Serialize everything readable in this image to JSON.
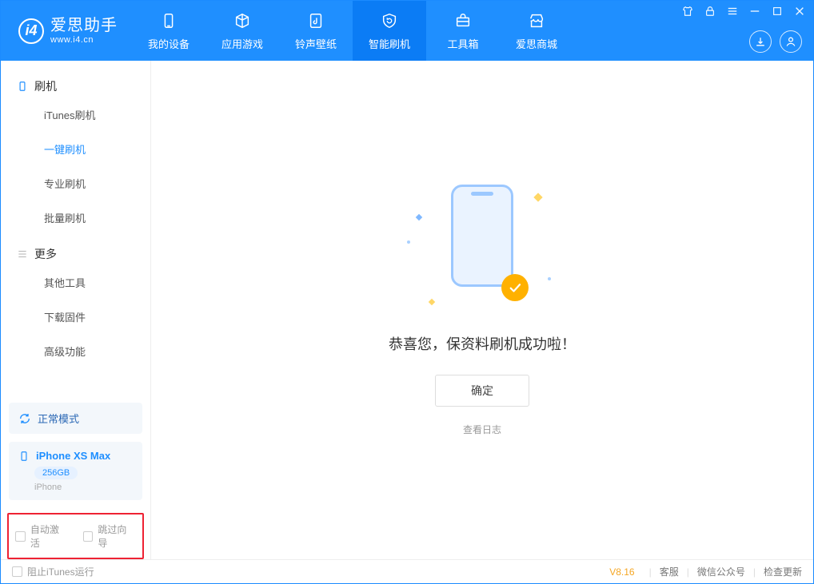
{
  "app": {
    "name": "爱思助手",
    "url": "www.i4.cn"
  },
  "tabs": [
    {
      "id": "device",
      "label": "我的设备"
    },
    {
      "id": "apps",
      "label": "应用游戏"
    },
    {
      "id": "ring",
      "label": "铃声壁纸"
    },
    {
      "id": "flash",
      "label": "智能刷机",
      "active": true
    },
    {
      "id": "tools",
      "label": "工具箱"
    },
    {
      "id": "store",
      "label": "爱思商城"
    }
  ],
  "sidebar": {
    "groups": [
      {
        "title": "刷机",
        "items": [
          {
            "id": "itunes",
            "label": "iTunes刷机"
          },
          {
            "id": "oneclick",
            "label": "一键刷机",
            "active": true
          },
          {
            "id": "pro",
            "label": "专业刷机"
          },
          {
            "id": "batch",
            "label": "批量刷机"
          }
        ]
      },
      {
        "title": "更多",
        "items": [
          {
            "id": "other",
            "label": "其他工具"
          },
          {
            "id": "fw",
            "label": "下载固件"
          },
          {
            "id": "adv",
            "label": "高级功能"
          }
        ]
      }
    ],
    "mode": "正常模式",
    "device": {
      "name": "iPhone XS Max",
      "capacity": "256GB",
      "type": "iPhone"
    },
    "checks": {
      "auto_activate": "自动激活",
      "skip_guide": "跳过向导"
    }
  },
  "main": {
    "success_msg": "恭喜您，保资料刷机成功啦！",
    "ok": "确定",
    "view_log": "查看日志"
  },
  "status": {
    "block_itunes": "阻止iTunes运行",
    "version": "V8.16",
    "links": {
      "support": "客服",
      "wechat": "微信公众号",
      "update": "检查更新"
    }
  }
}
